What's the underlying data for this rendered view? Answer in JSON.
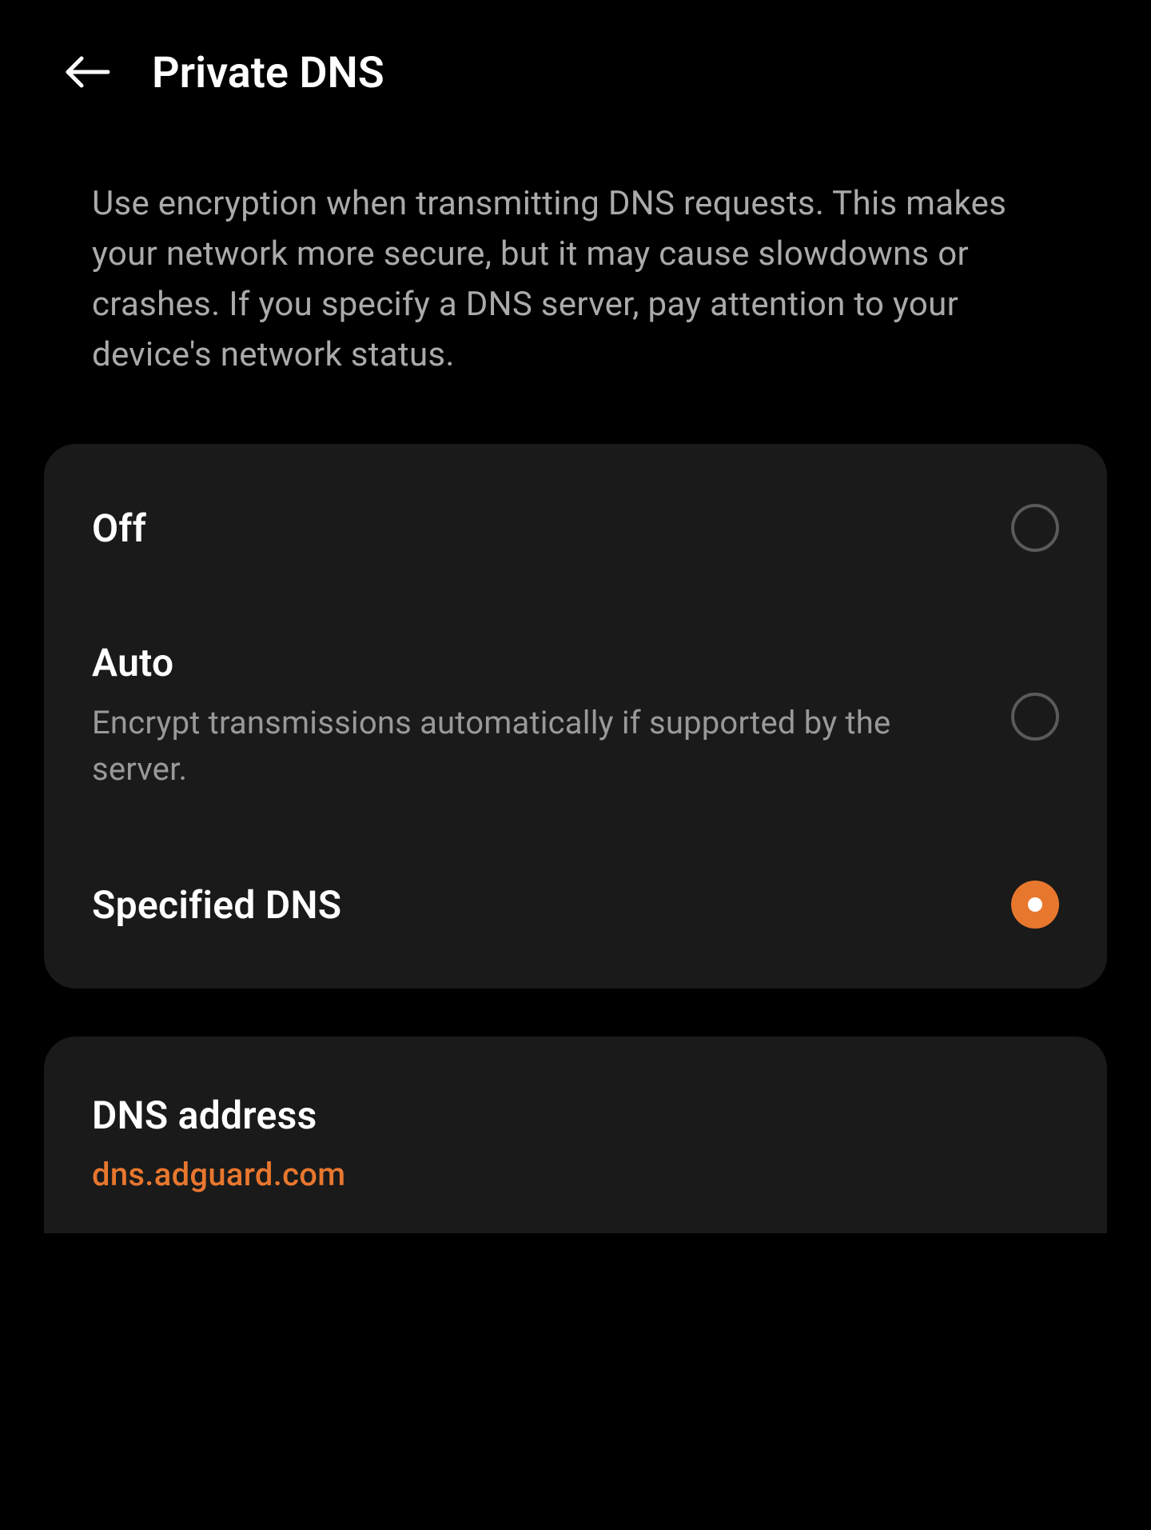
{
  "header": {
    "title": "Private DNS"
  },
  "description": "Use encryption when transmitting DNS requests. This makes your network more secure, but it may cause slowdowns or crashes. If you specify a DNS server, pay attention to your device's network status.",
  "options": {
    "off": {
      "title": "Off",
      "selected": false
    },
    "auto": {
      "title": "Auto",
      "subtitle": "Encrypt transmissions automatically if supported by the server.",
      "selected": false
    },
    "specified": {
      "title": "Specified DNS",
      "selected": true
    }
  },
  "dnsAddress": {
    "title": "DNS address",
    "value": "dns.adguard.com"
  },
  "colors": {
    "accent": "#e8772e",
    "background": "#000000",
    "cardBackground": "#1a1a1a",
    "textPrimary": "#ffffff",
    "textSecondary": "#999999"
  }
}
